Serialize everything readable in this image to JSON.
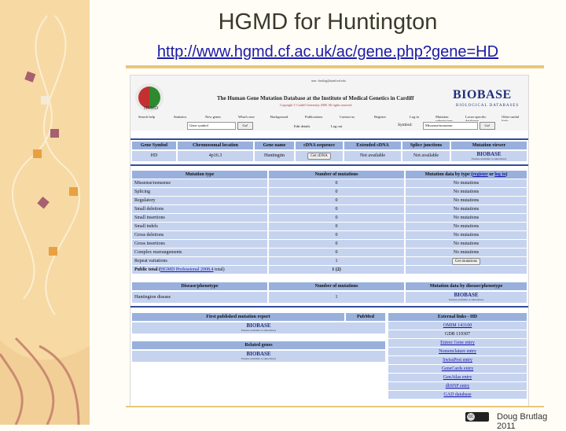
{
  "slide": {
    "title": "HGMD for Huntington",
    "url": "http://www.hgmd.cf.ac.uk/ac/gene.php?gene=HD",
    "credit": "Doug Brutlag 2011"
  },
  "site": {
    "user_line": "user: brutlag@stanford.edu",
    "title": "The Human Gene Mutation Database at the Institute of Medical Genetics in Cardiff",
    "copyright": "Copyright © Cardiff University 2008. All rights reserved.",
    "logo_text": "HGMD",
    "brand": "BIOBASE",
    "brand_sub": "BIOLOGICAL DATABASES",
    "nav": [
      "Search help",
      "Statistics",
      "New genes",
      "What's new",
      "Background",
      "Publications",
      "Contact us",
      "Register",
      "Log in",
      "Mutation submissions",
      "Locus-specific databases",
      "Other useful links"
    ],
    "gene_select": "Gene symbol",
    "go_label": "Go!",
    "edit_details": "Edit details",
    "log_out": "Log out",
    "symbol_label": "Symbol:",
    "mutation_select": "Missense/nonsense"
  },
  "colors": {
    "header_cell": "#99b0dc",
    "data_cell": "#c6d3ef",
    "rule": "#334c9a",
    "brand": "#21307a",
    "link": "#1a1aa8"
  },
  "gene_table": {
    "headers": [
      "Gene Symbol",
      "Chromosomal location",
      "Gene name",
      "cDNA sequence",
      "Extended cDNA",
      "Splice junctions",
      "Mutation viewer"
    ],
    "row": {
      "symbol": "HD",
      "location": "4p16.3",
      "name": "Huntingtin",
      "cdna_button": "Get cDNA",
      "extended": "Not available",
      "splice": "Not available"
    }
  },
  "mutation_table": {
    "headers": {
      "type": "Mutation type",
      "number": "Number of mutations",
      "data": "Mutation data by type (",
      "register": "register",
      "or": " or ",
      "login": "log in",
      "close": ")"
    },
    "rows": [
      {
        "type": "Missense/nonsense",
        "count": "0",
        "data": "No mutations"
      },
      {
        "type": "Splicing",
        "count": "0",
        "data": "No mutations"
      },
      {
        "type": "Regulatory",
        "count": "0",
        "data": "No mutations"
      },
      {
        "type": "Small deletions",
        "count": "0",
        "data": "No mutations"
      },
      {
        "type": "Small insertions",
        "count": "0",
        "data": "No mutations"
      },
      {
        "type": "Small indels",
        "count": "0",
        "data": "No mutations"
      },
      {
        "type": "Gross deletions",
        "count": "0",
        "data": "No mutations"
      },
      {
        "type": "Gross insertions",
        "count": "0",
        "data": "No mutations"
      },
      {
        "type": "Complex rearrangements",
        "count": "0",
        "data": "No mutations"
      },
      {
        "type": "Repeat variations",
        "count": "1",
        "data": "Get mutations"
      }
    ],
    "total": {
      "prefix": "Public total (",
      "link": "HGMD Professional 2008.4",
      "suffix": " total)",
      "count": "1 (2)"
    }
  },
  "disease_table": {
    "headers": [
      "Disease/phenotype",
      "Number of mutations",
      "Mutation data by disease/phenotype"
    ],
    "row": {
      "disease": "Huntington disease",
      "count": "1"
    }
  },
  "biobase_badge": {
    "brand": "BIOBASE",
    "sub": "Feature available to subscribers"
  },
  "publication": {
    "first_report": "First published mutation report",
    "pubmed": "PubMed",
    "related": "Related genes"
  },
  "external_links": {
    "header": "External links - HD",
    "items": [
      "OMIM 143100",
      "GDB 119307",
      "Entrez Gene entry",
      "Nomenclature entry",
      "SwissProt entry",
      "GeneCards entry",
      "GenAtlas entry",
      "dbSNP entry",
      "GAD database"
    ]
  }
}
